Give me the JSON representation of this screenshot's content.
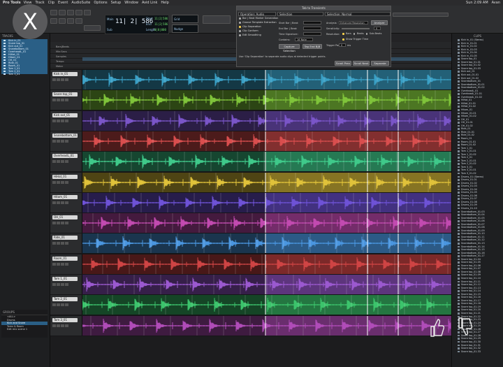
{
  "menubar": {
    "app_name": "Pro Tools",
    "items": [
      "View",
      "Track",
      "Clip",
      "Event",
      "AudioSuite",
      "Options",
      "Setup",
      "Window",
      "Avid Link",
      "Help"
    ],
    "right_items": [
      "Sun 2:09 AM",
      "Avan"
    ]
  },
  "close_button": {
    "glyph": "X"
  },
  "counter": {
    "main": "11| 2| 586",
    "main_label": "Main",
    "sub_label": "Sub",
    "start_label": "Start",
    "end_label": "End",
    "length_label": "Length",
    "start": "11|2|586",
    "end": "11|2|586",
    "length": "0|0|000",
    "nudge_label": "Nudge",
    "grid_label": "Grid"
  },
  "dialog": {
    "title": "Tab to Transients",
    "operation_label": "Operation:",
    "operation_value": "Audio",
    "operations": [
      {
        "label": "Bar | Beat Marker Generation",
        "selected": false
      },
      {
        "label": "Groove Template Extraction",
        "selected": false
      },
      {
        "label": "Clip Separation",
        "selected": true
      },
      {
        "label": "Clip Conform",
        "selected": false
      },
      {
        "label": "Edit Smoothing",
        "selected": false
      }
    ],
    "selection_label": "Selection",
    "start_bar_label": "Start Bar | Beat:",
    "end_bar_label": "End Bar | Beat:",
    "time_sig_label": "Time Signature:",
    "contains_label": "Contains:",
    "contains_value": "16 Note",
    "capture_button": "Capture Selection",
    "tap_end_button": "Tap End B|B",
    "selection2_label": "Selection:",
    "selection2_value": "Normal",
    "analysis_label": "Analysis:",
    "analysis_value": "Enhanced Resolution",
    "analyze_button": "Analyze",
    "sensitivity_label": "Sensitivity:",
    "sensitivity_value": "0",
    "resolution_label": "Resolution:",
    "resolution_options": [
      "Bars",
      "Beats",
      "Sub-Beats"
    ],
    "show_trigger_label": "Show Trigger Time",
    "trigger_pad_label": "Trigger Pad:",
    "trigger_pad_value": "0",
    "trigger_pad_unit": "ms",
    "help_text": "Use 'Clip Separation' to separate audio clips at detected trigger points.",
    "btn_prev": "Scroll Prev",
    "btn_next": "Scroll Next",
    "btn_separate": "Separate"
  },
  "rulers": [
    "Bars|Beats",
    "Min:Secs",
    "Samples",
    "Tempo",
    "Meter"
  ],
  "tracks": [
    {
      "name": "Kick in_01",
      "color": "#3aa0c6"
    },
    {
      "name": "Snare top_01",
      "color": "#7fc43a"
    },
    {
      "name": "Kick out_01",
      "color": "#7a55c8"
    },
    {
      "name": "Snarebottom_01",
      "color": "#d94e4e"
    },
    {
      "name": "OverheadL_01",
      "color": "#3fc98a"
    },
    {
      "name": "HiHat_01",
      "color": "#e0c23a"
    },
    {
      "name": "Hitom_01",
      "color": "#6e52d6"
    },
    {
      "name": "OH_01",
      "color": "#c24ab0"
    },
    {
      "name": "Ride_01",
      "color": "#4a96e0"
    },
    {
      "name": "Room_01",
      "color": "#cf4444"
    },
    {
      "name": "Tom 1_01",
      "color": "#9b59d0"
    },
    {
      "name": "Tom 2_01",
      "color": "#3cc46c"
    },
    {
      "name": "Tom 3_01",
      "color": "#b04cb8"
    }
  ],
  "left_panel": {
    "tracks_header": "TRACKS",
    "track_items": [
      "Kick in_01",
      "Snare top_01",
      "Kick out_01",
      "Snarebottom_01",
      "OverheadL_01",
      "HiHat_01",
      "Hitom_01",
      "OH_01",
      "Ride_01",
      "Room_01",
      "Tom 1_01",
      "Tom 2_01",
      "Tom 3_01"
    ],
    "groups_header": "GROUPS",
    "groups": [
      {
        "label": "<ALL>",
        "selected": false
      },
      {
        "label": "Drums",
        "selected": false
      },
      {
        "label": "Kick and Snare",
        "selected": true
      },
      {
        "label": "Toms & Room",
        "selected": false
      },
      {
        "label": "Edit mix scene 1",
        "selected": false
      }
    ]
  },
  "clips_panel": {
    "header": "CLIPS",
    "items": [
      "Kick in_01 (Stereo)",
      "Kick in_01-01",
      "Kick in_01-02",
      "Kick in_01-03",
      "Kick in_01-04",
      "Kick in_01-05",
      "Snare top_01",
      "Snare top_01-01",
      "Snare top_01-02",
      "Snare top_01-03",
      "Kick out_01",
      "Kick out_01-01",
      "Kick out_01-02",
      "Snarebottom_01",
      "Snarebottom_01-01",
      "Snarebottom_01-02",
      "OverheadL_01",
      "OverheadL_01-01",
      "OverheadL_01-02",
      "HiHat_01",
      "HiHat_01-01",
      "HiHat_01-02",
      "Hitom_01",
      "Hitom_01-01",
      "Hitom_01-02",
      "OH_01",
      "OH_01-01",
      "OH_01-02",
      "Ride_01",
      "Ride_01-01",
      "Ride_01-02",
      "Room_01",
      "Room_01-01",
      "Room_01-02",
      "Tom 1_01",
      "Tom 1_01-01",
      "Tom 1_01-02",
      "Tom 2_01",
      "Tom 2_01-01",
      "Tom 2_01-02",
      "Tom 3_01",
      "Tom 3_01-01",
      "Tom 3_01-02",
      "Drums_01 (Stereo)",
      "Drums_01-01",
      "Drums_01-02",
      "Drums_01-03",
      "Drums_01-04",
      "Drums_01-05",
      "Drums_01-06",
      "Drums_01-07",
      "Drums_01-08",
      "Drums_01-09",
      "Drums_01-10",
      "Snarebottom_01-03",
      "Snarebottom_01-04",
      "Snarebottom_01-05",
      "Snarebottom_01-06",
      "Snarebottom_01-07",
      "Snarebottom_01-08",
      "Snarebottom_01-09",
      "Snarebottom_01-10",
      "Snarebottom_01-11",
      "Snarebottom_01-12",
      "Snarebottom_01-13",
      "Snarebottom_01-14",
      "Snarebottom_01-15",
      "Snarebottom_01-16",
      "Snarebottom_01-17",
      "Snare top_01-04",
      "Snare top_01-05",
      "Snare top_01-06",
      "Snare top_01-07",
      "Snare top_01-08",
      "Snare top_01-09",
      "Snare top_01-10",
      "Snare top_01-11",
      "Snare top_01-12",
      "Snare top_01-13",
      "Snare top_01-14",
      "Snare top_01-15",
      "Snare top_01-16",
      "Snare top_01-17",
      "Snare top_01-18",
      "Snare top_01-19",
      "Snare top_01-20",
      "Snare top_01-21",
      "Snare top_01-22",
      "Snare top_01-23",
      "Snare top_01-24",
      "Snare top_01-25",
      "Snare top_01-26",
      "Snare top_01-27",
      "Snare top_01-28",
      "Snare top_01-29",
      "Snare top_01-30",
      "Snare top_01-31",
      "Snare top_01-32",
      "Snare top_01-33"
    ]
  },
  "feedback": {
    "thumbs_up_icon": "thumbs-up-icon",
    "thumbs_down_icon": "thumbs-down-icon"
  }
}
